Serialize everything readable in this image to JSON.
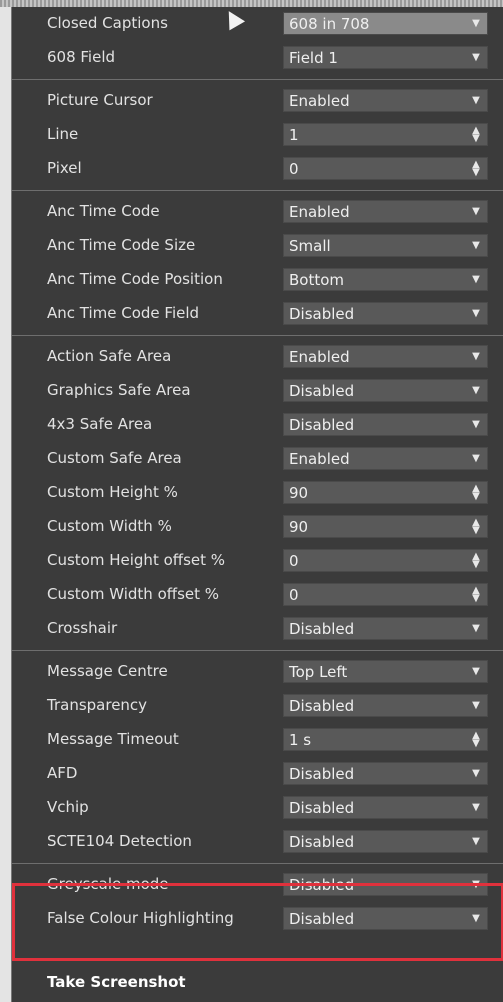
{
  "groups": [
    {
      "rows": [
        {
          "label": "Closed Captions",
          "value": "608 in 708",
          "control": "dropdown",
          "accent": true
        },
        {
          "label": "608 Field",
          "value": "Field 1",
          "control": "dropdown"
        }
      ]
    },
    {
      "rows": [
        {
          "label": "Picture Cursor",
          "value": "Enabled",
          "control": "dropdown"
        },
        {
          "label": "Line",
          "value": "1",
          "control": "spinner"
        },
        {
          "label": "Pixel",
          "value": "0",
          "control": "spinner"
        }
      ]
    },
    {
      "rows": [
        {
          "label": "Anc Time Code",
          "value": "Enabled",
          "control": "dropdown"
        },
        {
          "label": "Anc Time Code Size",
          "value": "Small",
          "control": "dropdown"
        },
        {
          "label": "Anc Time Code Position",
          "value": "Bottom",
          "control": "dropdown"
        },
        {
          "label": "Anc Time Code Field",
          "value": "Disabled",
          "control": "dropdown"
        }
      ]
    },
    {
      "rows": [
        {
          "label": "Action Safe Area",
          "value": "Enabled",
          "control": "dropdown"
        },
        {
          "label": "Graphics Safe Area",
          "value": "Disabled",
          "control": "dropdown"
        },
        {
          "label": "4x3 Safe Area",
          "value": "Disabled",
          "control": "dropdown"
        },
        {
          "label": "Custom Safe Area",
          "value": "Enabled",
          "control": "dropdown"
        },
        {
          "label": "Custom Height %",
          "value": "90",
          "control": "spinner"
        },
        {
          "label": "Custom Width %",
          "value": "90",
          "control": "spinner"
        },
        {
          "label": "Custom Height offset %",
          "value": "0",
          "control": "spinner"
        },
        {
          "label": "Custom Width offset %",
          "value": "0",
          "control": "spinner"
        },
        {
          "label": "Crosshair",
          "value": "Disabled",
          "control": "dropdown"
        }
      ]
    },
    {
      "rows": [
        {
          "label": "Message Centre",
          "value": "Top Left",
          "control": "dropdown"
        },
        {
          "label": "Transparency",
          "value": "Disabled",
          "control": "dropdown"
        },
        {
          "label": "Message Timeout",
          "value": "1 s",
          "control": "spinner"
        },
        {
          "label": "AFD",
          "value": "Disabled",
          "control": "dropdown"
        },
        {
          "label": "Vchip",
          "value": "Disabled",
          "control": "dropdown"
        },
        {
          "label": "SCTE104 Detection",
          "value": "Disabled",
          "control": "dropdown"
        }
      ]
    },
    {
      "rows": [
        {
          "label": "Greyscale mode",
          "value": "Disabled",
          "control": "dropdown"
        },
        {
          "label": "False Colour Highlighting",
          "value": "Disabled",
          "control": "dropdown"
        }
      ]
    }
  ],
  "footer": {
    "label": "Take Screenshot"
  },
  "icons": {
    "dropdown": "chevron-down-icon",
    "spinner": "spinner-arrows-icon"
  },
  "colors": {
    "highlight": "#e0313c",
    "accent_control": "#8a8a8a",
    "control": "#595959",
    "panel": "#3b3b3b"
  }
}
